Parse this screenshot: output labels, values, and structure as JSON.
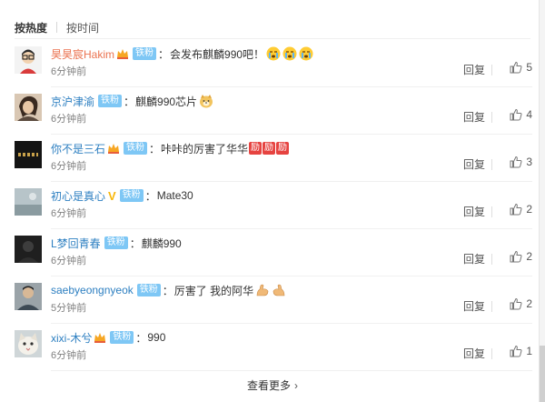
{
  "sort": {
    "hot": "按热度",
    "time": "按时间"
  },
  "comments": [
    {
      "user": "昊昊宸Hakim",
      "user_color": "#eb7350",
      "crown": true,
      "fan_badge": "铁粉",
      "colon": "：",
      "text": "会发布麒麟990吧！",
      "emoji": [
        "crying-face",
        "crying-face",
        "crying-face"
      ],
      "time": "6分钟前",
      "reply": "回复",
      "likes": "5"
    },
    {
      "user": "京沪津渝",
      "user_color": "#2d7fc1",
      "crown": false,
      "fan_badge": "铁粉",
      "colon": "：",
      "text": "麒麟990芯片",
      "emoji": [
        "doge-face"
      ],
      "time": "6分钟前",
      "reply": "回复",
      "likes": "4"
    },
    {
      "user": "你不是三石",
      "user_color": "#2d7fc1",
      "crown": true,
      "fan_badge": "铁粉",
      "colon": "：",
      "text": "咔咔的厉害了华华",
      "tags": [
        "励",
        "励",
        "励"
      ],
      "time": "6分钟前",
      "reply": "回复",
      "likes": "3"
    },
    {
      "user": "初心是真心",
      "user_color": "#2d7fc1",
      "crown": false,
      "verified": "V",
      "fan_badge": "铁粉",
      "colon": "：",
      "text": "Mate30",
      "time": "6分钟前",
      "reply": "回复",
      "likes": "2"
    },
    {
      "user": "L梦回青春",
      "user_color": "#2d7fc1",
      "crown": false,
      "fan_badge": "铁粉",
      "colon": "：",
      "text": "麒麟990",
      "time": "6分钟前",
      "reply": "回复",
      "likes": "2"
    },
    {
      "user": "saebyeongnyeok",
      "user_color": "#2d7fc1",
      "crown": false,
      "fan_badge": "铁粉",
      "colon": "：",
      "text": "厉害了 我的阿华",
      "emoji": [
        "flexed-biceps",
        "flexed-biceps"
      ],
      "time": "5分钟前",
      "reply": "回复",
      "likes": "2"
    },
    {
      "user": "xixi-木兮",
      "user_color": "#2d7fc1",
      "crown": true,
      "fan_badge": "铁粉",
      "colon": "：",
      "text": "990",
      "time": "6分钟前",
      "reply": "回复",
      "likes": "1"
    }
  ],
  "more": {
    "label": "查看更多",
    "chevron": "›"
  },
  "icons": {
    "like": "thumbs-up-icon",
    "crown": "crown-icon"
  }
}
